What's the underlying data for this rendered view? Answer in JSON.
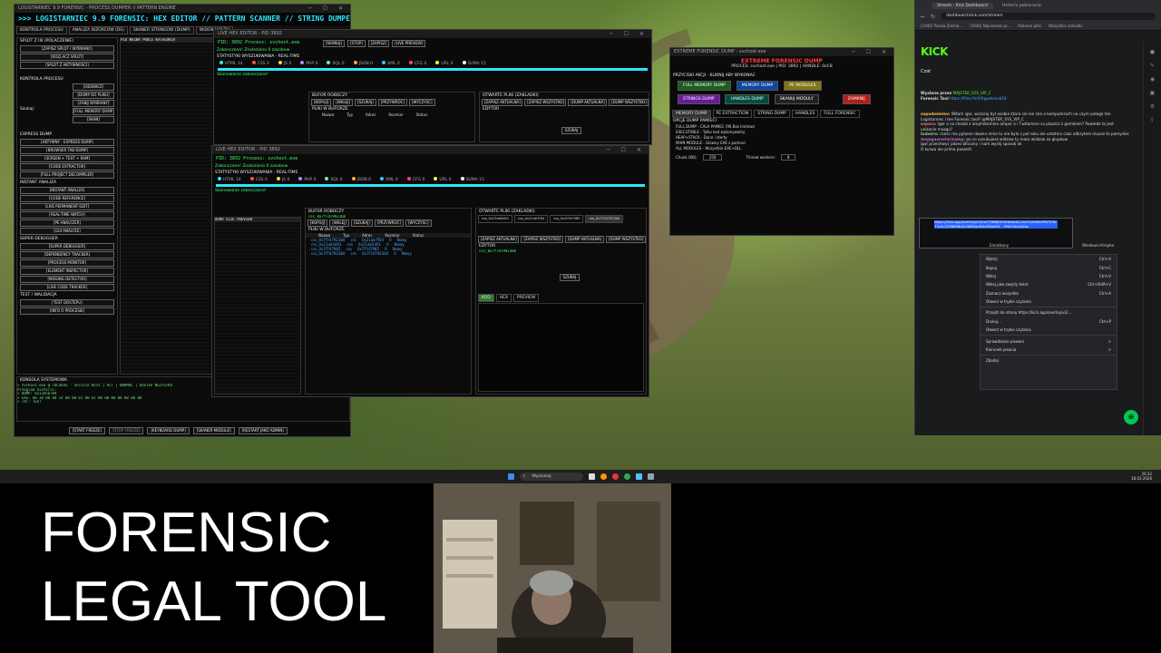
{
  "forensic": {
    "title": "LOGISTARNIEC 9.9 FORENSIC - PROCESS DUMPER // PATTERN ENGINE",
    "banner": ">>> LOGISTARNIEC 9.9 FORENSIC: HEX EDITOR // PATTERN SCANNER // STRING DUMPER // EX",
    "tabs": [
      "KONTROLA PROCESU",
      "ANALIZA WZORCOW (DS)",
      "SKANER STRINGOW (DUMP)",
      "WIDOK HOLDU"
    ],
    "left_panel_title": "SPLOT Z IIII (POLACZENIE)",
    "left_buttons": [
      "[ZAPISZ SPLOT I WYBRANO]",
      "[ROZLACZ SPLOT]",
      "[SPLOT Z AKTYWNOSCI]"
    ],
    "process_label": "KONTROLA PROCESU",
    "process_buttons": [
      "[ODSWIEZ]",
      "[DUMP DO PLIKU]",
      "[ZABIJ WYBRANY]",
      "[FULL MEMORY DUMP]",
      "[SKAN]"
    ],
    "search_label": "Szukaj:",
    "express_label": "EXPRESS DUMP",
    "express_buttons": [
      "[AKTYWNY - EXPRESS DUMP]",
      "[BROWSER TAB DUMP]",
      "[SCREEN + TEXT + RAM]",
      "[CODE EXTRACTOR]",
      "[FULL PROJECT DECOMPILER]"
    ],
    "instant_label": "INSTANT ANALIZA",
    "instant_buttons": [
      "[INSTANT ANALIZA]",
      "[CODE-REFERENCE]",
      "[LIVE PERMANENT EDIT]",
      "[REAL-TIME WATCH]",
      "[PE ANALYZER]",
      "[GUI ANALYZE]"
    ],
    "debugger_label": "SUPER DEBUGGER",
    "debugger_buttons": [
      "[SUPER DEBUGGER]",
      "[DEPENDENCY TRACKER]",
      "[PROCESS MONITOR]",
      "[ELEMENT INSPECTOR]",
      "[MISSING DETECTOR]",
      "[LIVE CODE TRACKER]"
    ],
    "test_label": "TEST / WALIDACJA",
    "test_buttons": [
      "[TEST DOSTEPU]",
      "[INFO O PROCESIE]"
    ],
    "console_label": "KONSOLA SYSTEMOWA",
    "console_lines": [
      "> svchost.exe   @ TDC4693 - Service Host  | ACT   | NORMAL  | DOSTEP WSZYSTKO",
      "Przeglad historii:",
      "",
      "> DUMP: 0123456789",
      "> EXE: 00 38 00 00 14 00 00 01 00 01 00 00 00 00 00 00 00",
      "> TXT: TEXT"
    ],
    "bottom_buttons": [
      "[START FREEZE]",
      "[STOP FREEZE]",
      "[KEYBOARD DUMP]",
      "[SKANER MODULE]",
      "[RESTART JAKO ADMIN]"
    ]
  },
  "hex1": {
    "title": "LIVE HEX EDITOR - PID 3892",
    "pid_line": "PID: 3892  Process: svchost.exe",
    "buttons": [
      "[SKANUJ]",
      "[STOP]",
      "[ZAPISZ]",
      "[LIVE PREVIEW]"
    ],
    "status": "Zakonczone! Znaleziono 0 zasobow",
    "stats_label": "STATYSTYKI WYSZUKIWANIA - REAL-TIME",
    "stats": [
      "HTML 14",
      "CSS 0",
      "JS 0",
      "PHP 0",
      "SQL 0",
      "JSON 0",
      "XML 0",
      "CFG 0",
      "URL 0",
      "SUMA 15"
    ],
    "scan_done": "Skanowanie zakonczone!",
    "buffer_label": "BUFOR ROBOCZY",
    "files_label": "OTWARTE PLIKI (ZAKLADKI)",
    "buffer_buttons": [
      "[KOPIUJ]",
      "[WKLEJ]",
      "[SZUKAJ]",
      "[PRZYWROC]",
      "[WYCZYSC]"
    ],
    "files_buttons": [
      "[ZAPISZ AKTUALNA]",
      "[ZAPISZ WSZYSTKO]",
      "[DUMP AKTUALNA]",
      "[DUMP WSZYSTKO]"
    ],
    "editor_label": "EDYTOR",
    "in_buffer_label": "PLIKI W BUFORZE",
    "table_headers": [
      "Nazwa",
      "Typ",
      "Adres",
      "Rozmiar",
      "Status"
    ],
    "search_btn": "SZUKAJ"
  },
  "hex2": {
    "title": "LIVE HEX EDITOR - PID 3892",
    "pid_line": "PID: 3892  Process: svchost.exe",
    "status": "Zakonczone! Znaleziono 0 zasobow",
    "stats_label": "STATYSTYKI WYSZUKIWANIA - REAL-TIME",
    "scan_done": "Skanowanie zakonczone!",
    "active_file": "css_0x7f7d79923b0",
    "tabs": [
      "css_0x21ab5d01",
      "css_0x21ab7f04",
      "css_0x2f7d7985",
      "css_0x7f7d7923b0"
    ],
    "code_tabs": [
      "KOD",
      "HEX",
      "PREVIEW"
    ],
    "rows": [
      [
        "css_0x7f7d7923b0",
        "css",
        "0x21ab7f04",
        "0",
        "Nowy"
      ],
      [
        "css_0x21ab5d01",
        "css",
        "0x21ab5d01",
        "0",
        "Nowy"
      ],
      [
        "css_0x7f7d7985",
        "css",
        "0x7f7d7985",
        "0",
        "Nowy"
      ],
      [
        "css_0x7f7d7923b0",
        "css",
        "0x7f7d7923b0",
        "0",
        "Nowy"
      ]
    ]
  },
  "dump": {
    "window_title": "EXTREME FORENSIC DUMP - svchost.exe",
    "title": "EXTREME FORENSIC DUMP",
    "subtitle": "PROCES: svchost.exe | PID: 3892 | HANDLE: 0xC8",
    "section": "PRZYCISKI AKCJI - KLIKNIJ ABY WYKONAC",
    "buttons": [
      "FULL MEMORY DUMP",
      "MEMORY DUMP",
      "PE MODULES",
      "STRINGS DUMP",
      "HANDLES DUMP",
      "SKANUJ MODULY",
      "ZAMKNIJ"
    ],
    "tabs": [
      "MEMORY DUMP",
      "PE EXTRACTION",
      "STRING DUMP",
      "HANDLES",
      "FULL FORENSIC"
    ],
    "options_label": "OPCJE DUMP PAMIECI",
    "options": [
      "FULL DUMP - CALA PAMIEC (96 Bez limitow)",
      "EXECUTABLE - Tylko kod wykonywalny",
      "HEAP+STACK - Dane i sterty",
      "MAIN MODULE - Glowny EXE z pamieci",
      "ALL MODULES - Wszystkie EXE+DLL"
    ],
    "chunk_label": "Chunk (KB):",
    "chunk_value": "256",
    "threads_label": "Thread workers:",
    "threads_value": "8"
  },
  "browser": {
    "tabs": [
      "Stream - Kick Dashboard",
      "Historia pobierania"
    ],
    "address": "dashboard.kick.com/stream",
    "bookmarks": [
      "(1946) Plaska Ziemia...",
      "(1946) Najnowsze pr...",
      "Pobrane pliki",
      "Wszystkie zakladki"
    ],
    "logo": "KICK",
    "chat_label": "Czat",
    "chat_lines": [
      {
        "user": "Wyslane przez",
        "text": "MAJSTER_SYS_VIP_C"
      },
      {
        "user": "Forensic Tool",
        "text": "https://files.fm/f/4gwekivvb54"
      },
      {
        "user": "sapdesleiev:",
        "text": "Witam igor, wczoraj bylo sporo wszystkiego, to wczoraj bylo to problematyczne z Logistarniec i tem Forensic tool?"
      },
      {
        "user": "sapodesleiev:",
        "text": "Witam igor, wczoraj byl osobie ktora sie nie zna o komputerach na czym polega ten Logistarniec i ten Forensic tool? @MAJSTER_SYS_VIP_C"
      },
      {
        "user": "ssporo:",
        "text": "Igor o co chodzi z amphetamine amper a i f witamine co plaszcz z gemkiem? Powiedz to jest unikacie mozgu?"
      },
      {
        "user": "hubeiro:",
        "text": "czesc ma pytanie dawno mnie tu nie bylo z pol roku ale ostatnio czas odkrytem musze to pomyslec"
      },
      {
        "user": "mojagawnelarizamp:",
        "text": "po co oszukujesz widzow ty masz widzow za glupkow"
      },
      {
        "user": "",
        "text": "igor przechwyc jakies bitcoiny i nam wyslij sposob ok"
      },
      {
        "user": "",
        "text": "O kurwa ale prime poszedl"
      }
    ],
    "selected_text": "https://kick.app/overlay/v2/me7786600?ef4ebcb11ee702e80d3f6743b73c5c2238696d2c3892ac82b5f9a495... 99fc54ca42bc",
    "context_menu": [
      {
        "label": "Wytnij",
        "shortcut": "Ctrl+X"
      },
      {
        "label": "Kopiuj",
        "shortcut": "Ctrl+C"
      },
      {
        "label": "Wklej",
        "shortcut": "Ctrl+V"
      },
      {
        "label": "Wklej jako zwykly tekst",
        "shortcut": "Ctrl+Shift+V"
      },
      {
        "label": "Zaznacz wszystko",
        "shortcut": "Ctrl+A"
      },
      {
        "label": "Otworz w trybie czytania",
        "shortcut": ""
      },
      {
        "label": "Przejdz do strony https://kick.app/overlay/v2/...",
        "shortcut": ""
      },
      {
        "label": "Drukuj...",
        "shortcut": "Ctrl+P"
      },
      {
        "label": "Otworz w trybie czytania",
        "shortcut": ""
      },
      {
        "label": "Sprawdzanie pisowni",
        "shortcut": ">"
      },
      {
        "label": "Kierunek pisania",
        "shortcut": ">"
      },
      {
        "label": "Zbadaj",
        "shortcut": ""
      }
    ],
    "windows_ctx": "Windows+Kropka",
    "emoji_label": "Emotikony"
  },
  "taskbar": {
    "search": "Wyszukaj",
    "time": "20:32",
    "date": "18.03.2026"
  },
  "caption": {
    "line1": "FORENSIC",
    "line2": "LEGAL TOOL"
  }
}
